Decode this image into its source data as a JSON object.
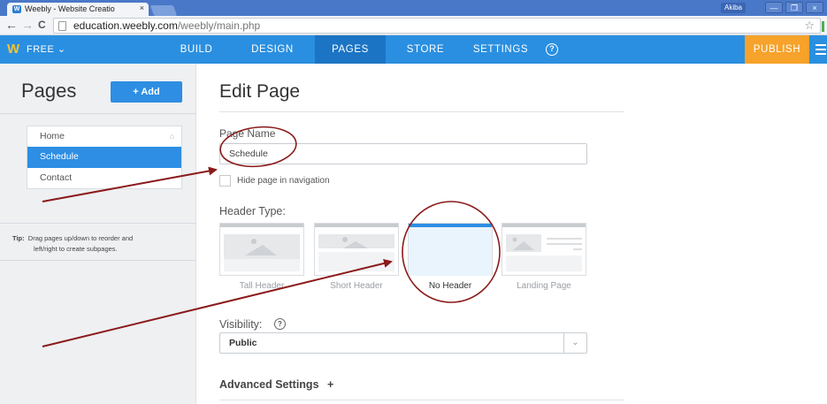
{
  "browser": {
    "tab_title": "Weebly - Website Creatio",
    "tab_close": "×",
    "user_badge": "Akiba",
    "window_controls": [
      "—",
      "❐",
      "×"
    ],
    "back": "←",
    "forward": "→",
    "reload": "C",
    "url_host": "education.weebly.com",
    "url_path": "/weebly/main.php",
    "star": "☆"
  },
  "nav": {
    "logo": "W",
    "plan": "FREE ⌄",
    "items": [
      "BUILD",
      "DESIGN",
      "PAGES",
      "STORE",
      "SETTINGS"
    ],
    "active": "PAGES",
    "help": "?",
    "publish": "PUBLISH"
  },
  "sidebar": {
    "title": "Pages",
    "add_label": "+ Add",
    "pages": [
      {
        "label": "Home",
        "icon": "home-icon"
      },
      {
        "label": "Schedule"
      },
      {
        "label": "Contact"
      }
    ],
    "tip_label": "Tip:",
    "tip_line1": "Drag pages up/down to reorder and",
    "tip_line2": "left/right to create subpages."
  },
  "edit": {
    "title": "Edit Page",
    "page_name_label": "Page Name",
    "page_name_value": "Schedule",
    "hide_label": "Hide page in navigation",
    "header_type_label": "Header Type:",
    "header_types": [
      "Tall Header",
      "Short Header",
      "No Header",
      "Landing Page"
    ],
    "selected_header": "No Header",
    "visibility_label": "Visibility:",
    "visibility_help": "?",
    "visibility_value": "Public",
    "advanced_label": "Advanced Settings",
    "advanced_plus": "+"
  },
  "colors": {
    "accent": "#2d8ee3",
    "publish": "#f7a22b",
    "annotation": "#8b1a1a"
  }
}
